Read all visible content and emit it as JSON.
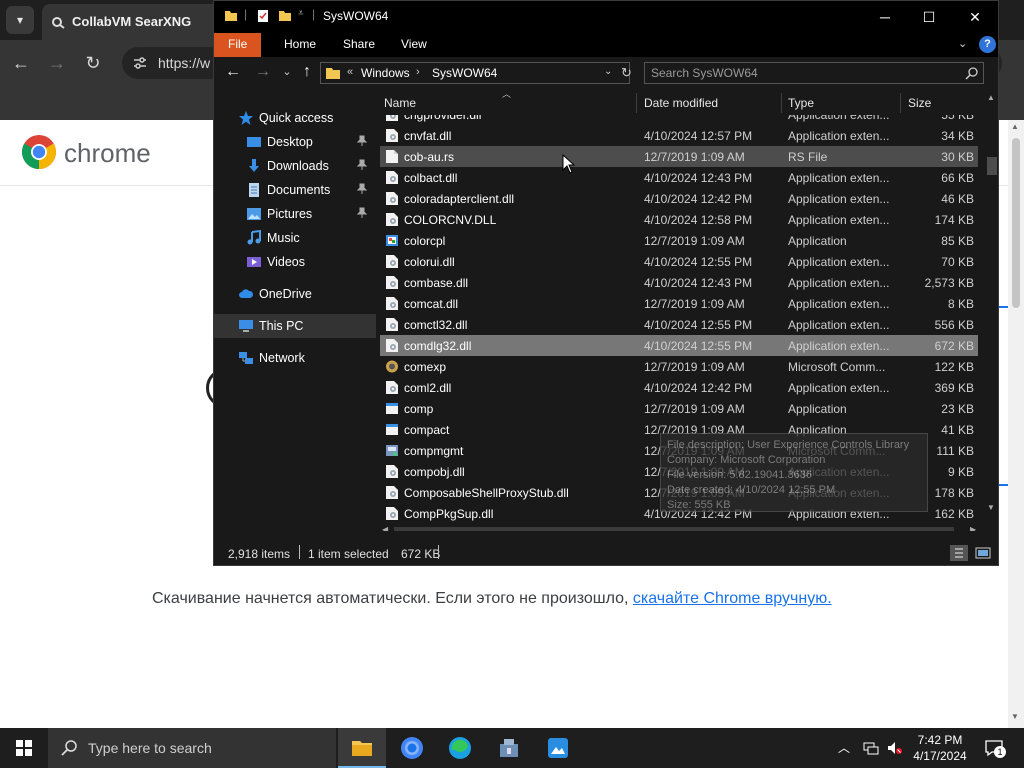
{
  "browser": {
    "tab_title": "CollabVM SearXNG",
    "url": "https://w",
    "page": {
      "wordmark": "chrome",
      "info_text": "Скачивание начнется автоматически. Если этого не произошло, ",
      "info_link": "скачайте Chrome вручную."
    }
  },
  "explorer": {
    "title": "SysWOW64",
    "ribbon_tabs": [
      "File",
      "Home",
      "Share",
      "View"
    ],
    "address": {
      "separator": "«",
      "crumbs": [
        "Windows",
        "SysWOW64"
      ]
    },
    "search_placeholder": "Search SysWOW64",
    "nav": {
      "quick_access": "Quick access",
      "desktop": "Desktop",
      "downloads": "Downloads",
      "documents": "Documents",
      "pictures": "Pictures",
      "music": "Music",
      "videos": "Videos",
      "onedrive": "OneDrive",
      "this_pc": "This PC",
      "network": "Network"
    },
    "columns": {
      "name": "Name",
      "date": "Date modified",
      "type": "Type",
      "size": "Size"
    },
    "files": [
      {
        "name": "chgprovider.dll",
        "date": "",
        "type": "Application exten...",
        "size": "55 KB",
        "icon": "dll"
      },
      {
        "name": "cnvfat.dll",
        "date": "4/10/2024 12:57 PM",
        "type": "Application exten...",
        "size": "34 KB",
        "icon": "dll"
      },
      {
        "name": "cob-au.rs",
        "date": "12/7/2019 1:09 AM",
        "type": "RS File",
        "size": "30 KB",
        "icon": "file"
      },
      {
        "name": "colbact.dll",
        "date": "4/10/2024 12:43 PM",
        "type": "Application exten...",
        "size": "66 KB",
        "icon": "dll"
      },
      {
        "name": "coloradapterclient.dll",
        "date": "4/10/2024 12:42 PM",
        "type": "Application exten...",
        "size": "46 KB",
        "icon": "dll"
      },
      {
        "name": "COLORCNV.DLL",
        "date": "4/10/2024 12:58 PM",
        "type": "Application exten...",
        "size": "174 KB",
        "icon": "dll"
      },
      {
        "name": "colorcpl",
        "date": "12/7/2019 1:09 AM",
        "type": "Application",
        "size": "85 KB",
        "icon": "app-color"
      },
      {
        "name": "colorui.dll",
        "date": "4/10/2024 12:55 PM",
        "type": "Application exten...",
        "size": "70 KB",
        "icon": "dll"
      },
      {
        "name": "combase.dll",
        "date": "4/10/2024 12:43 PM",
        "type": "Application exten...",
        "size": "2,573 KB",
        "icon": "dll"
      },
      {
        "name": "comcat.dll",
        "date": "12/7/2019 1:09 AM",
        "type": "Application exten...",
        "size": "8 KB",
        "icon": "dll"
      },
      {
        "name": "comctl32.dll",
        "date": "4/10/2024 12:55 PM",
        "type": "Application exten...",
        "size": "556 KB",
        "icon": "dll"
      },
      {
        "name": "comdlg32.dll",
        "date": "4/10/2024 12:55 PM",
        "type": "Application exten...",
        "size": "672 KB",
        "icon": "dll"
      },
      {
        "name": "comexp",
        "date": "12/7/2019 1:09 AM",
        "type": "Microsoft Comm...",
        "size": "122 KB",
        "icon": "msc"
      },
      {
        "name": "coml2.dll",
        "date": "4/10/2024 12:42 PM",
        "type": "Application exten...",
        "size": "369 KB",
        "icon": "dll"
      },
      {
        "name": "comp",
        "date": "12/7/2019 1:09 AM",
        "type": "Application",
        "size": "23 KB",
        "icon": "app"
      },
      {
        "name": "compact",
        "date": "12/7/2019 1:09 AM",
        "type": "Application",
        "size": "41 KB",
        "icon": "app"
      },
      {
        "name": "compmgmt",
        "date": "12/7/2019 1:09 AM",
        "type": "Microsoft Comm...",
        "size": "111 KB",
        "icon": "msc2"
      },
      {
        "name": "compobj.dll",
        "date": "12/7/2019 1:09 AM",
        "type": "Application exten...",
        "size": "9 KB",
        "icon": "dll"
      },
      {
        "name": "ComposableShellProxyStub.dll",
        "date": "12/7/2019 1:09 AM",
        "type": "Application exten...",
        "size": "178 KB",
        "icon": "dll"
      },
      {
        "name": "CompPkgSup.dll",
        "date": "4/10/2024 12:42 PM",
        "type": "Application exten...",
        "size": "162 KB",
        "icon": "dll"
      }
    ],
    "hover_index": 2,
    "selected_index": 11,
    "tooltip": [
      "File description: User Experience Controls Library",
      "Company: Microsoft Corporation",
      "File version: 5.82.19041.3636",
      "Date created: 4/10/2024 12:55 PM",
      "Size: 555 KB"
    ],
    "status": {
      "items": "2,918 items",
      "selected": "1 item selected",
      "selected_size": "672 KB"
    }
  },
  "taskbar": {
    "search_placeholder": "Type here to search",
    "time": "7:42 PM",
    "date": "4/17/2024",
    "notification_count": "1"
  },
  "colors": {
    "ribbon_file": "#d9541e",
    "explorer_bg": "#191919",
    "selected_row": "#777777",
    "link": "#1a73e8"
  }
}
